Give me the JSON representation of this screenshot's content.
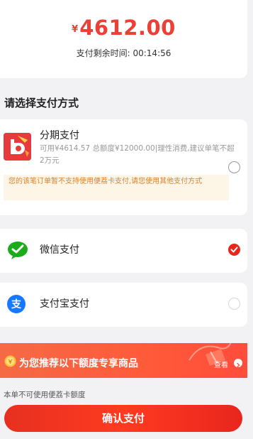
{
  "payment": {
    "currency_symbol": "¥",
    "amount": "4612.00",
    "countdown_label": "支付剩余时间:",
    "countdown_value": "00:14:56"
  },
  "section_title": "请选择支付方式",
  "methods": {
    "installment": {
      "name": "分期支付",
      "description": "可用¥4614.57 总额度¥12000.00|理性消费,建议单笔不超2万元",
      "warning": "您的该笔订单暂不支持使用便荔卡支付,请您使用其他支付方式",
      "selected": false,
      "icon": "installment-logo-icon"
    },
    "wechat": {
      "name": "微信支付",
      "selected": true,
      "icon": "wechat-pay-icon"
    },
    "alipay": {
      "name": "支付宝支付",
      "selected": false,
      "icon": "alipay-icon"
    }
  },
  "promo": {
    "title": "为您推荐以下额度专享商品",
    "link_label": "查看",
    "icon": "coin-icon"
  },
  "note": "本单不可使用便荔卡额度",
  "confirm_button": "确认支付",
  "colors": {
    "accent": "#e8261e",
    "amount": "#ec3f35",
    "warning_text": "#d9822b",
    "warning_bg": "#fdf5e6",
    "wechat_green": "#1aad19",
    "alipay_blue": "#1677ff"
  }
}
